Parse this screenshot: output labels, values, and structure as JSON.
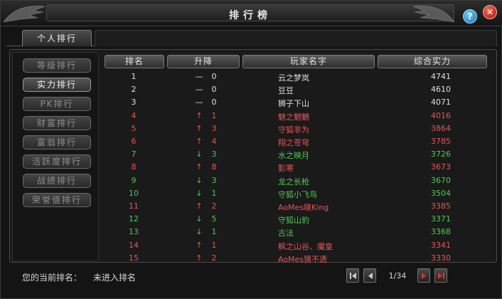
{
  "window": {
    "title": "排行榜"
  },
  "tabs": [
    {
      "label": "个人排行"
    }
  ],
  "sidebar": {
    "items": [
      {
        "label": "等级排行",
        "active": false
      },
      {
        "label": "实力排行",
        "active": true
      },
      {
        "label": "PK排行",
        "active": false
      },
      {
        "label": "财富排行",
        "active": false
      },
      {
        "label": "富翁排行",
        "active": false
      },
      {
        "label": "活跃度排行",
        "active": false
      },
      {
        "label": "战绩排行",
        "active": false
      },
      {
        "label": "荣誉值排行",
        "active": false
      }
    ]
  },
  "table": {
    "headers": {
      "rank": "排名",
      "change": "升降",
      "name": "玩家名字",
      "power": "综合实力"
    },
    "rows": [
      {
        "rank": "1",
        "dir": "same",
        "chg": "0",
        "name": "云之梦岚",
        "power": "4741",
        "color": "white"
      },
      {
        "rank": "2",
        "dir": "same",
        "chg": "0",
        "name": "豆豆",
        "power": "4610",
        "color": "white"
      },
      {
        "rank": "3",
        "dir": "same",
        "chg": "0",
        "name": "狮子下山",
        "power": "4071",
        "color": "white"
      },
      {
        "rank": "4",
        "dir": "up",
        "chg": "1",
        "name": "魅之魍魉",
        "power": "4016",
        "color": "red"
      },
      {
        "rank": "5",
        "dir": "up",
        "chg": "3",
        "name": "守狐非为",
        "power": "3864",
        "color": "red"
      },
      {
        "rank": "6",
        "dir": "up",
        "chg": "4",
        "name": "翔之苍穹",
        "power": "3785",
        "color": "red"
      },
      {
        "rank": "7",
        "dir": "down",
        "chg": "3",
        "name": "水之映月",
        "power": "3726",
        "color": "green"
      },
      {
        "rank": "8",
        "dir": "up",
        "chg": "8",
        "name": "影寒",
        "power": "3673",
        "color": "red"
      },
      {
        "rank": "9",
        "dir": "down",
        "chg": "3",
        "name": "龙之长枪",
        "power": "3670",
        "color": "green"
      },
      {
        "rank": "10",
        "dir": "down",
        "chg": "1",
        "name": "守狐小飞鸟",
        "power": "3504",
        "color": "green"
      },
      {
        "rank": "11",
        "dir": "up",
        "chg": "2",
        "name": "AoMes晓King",
        "power": "3385",
        "color": "red"
      },
      {
        "rank": "12",
        "dir": "down",
        "chg": "5",
        "name": "守狐山豹",
        "power": "3371",
        "color": "green"
      },
      {
        "rank": "13",
        "dir": "down",
        "chg": "1",
        "name": "古法",
        "power": "3368",
        "color": "green"
      },
      {
        "rank": "14",
        "dir": "up",
        "chg": "1",
        "name": "枫之山谷、魔皇",
        "power": "3341",
        "color": "red"
      },
      {
        "rank": "15",
        "dir": "up",
        "chg": "2",
        "name": "AoMes猜不透",
        "power": "3330",
        "color": "red"
      }
    ]
  },
  "footer": {
    "current_rank_label": "您的当前排名：",
    "current_rank_value": "未进入排名",
    "page": "1/34"
  },
  "colors": {
    "up": "#e35656",
    "down": "#4fc94f",
    "same": "#e0e0e0"
  },
  "icons": {
    "first": "first-page-icon",
    "prev": "prev-page-icon",
    "next": "next-page-icon",
    "last": "last-page-icon",
    "help": "help-icon",
    "close": "close-icon"
  }
}
